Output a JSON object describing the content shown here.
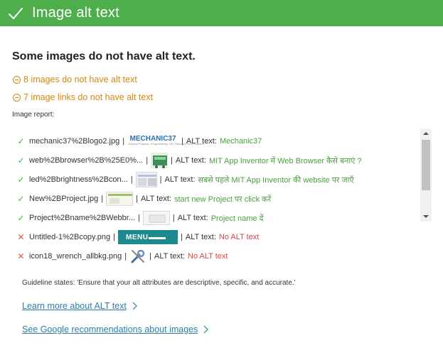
{
  "header": {
    "title": "Image alt text",
    "bg_color": "#4fae4c"
  },
  "summary": {
    "headline": "Some images do not have alt text.",
    "issues": [
      "8 images do not have alt text",
      "7 image links do not have alt text"
    ],
    "issue_color": "#d4880f"
  },
  "report": {
    "label": "Image report:",
    "alt_label": "ALT text:",
    "rows": [
      {
        "status": "ok",
        "file": "mechanic37%2Blogo2.jpg",
        "thumb": "mechanic37-logo",
        "thumb_text": "MECHANIC37",
        "thumb_subtext": "Arduino Projects, Programming, DIY, Robotics\nDo It Yourself",
        "alt": "Mechanic37"
      },
      {
        "status": "ok",
        "file": "web%2Bbrowser%2B%25E0%...",
        "thumb": "browser-thumbnail",
        "alt": "MIT App Inventor में Web Browser कैसे बनाएं ?"
      },
      {
        "status": "ok",
        "file": "led%2Bbrightness%2Bcon...",
        "thumb": "led-thumbnail",
        "alt": "सबसे पहले MIT App Inventor की website पर जाएँ"
      },
      {
        "status": "ok",
        "file": "New%2BProject.jpg",
        "thumb": "project-thumbnail",
        "alt": "start new Project पर click करें"
      },
      {
        "status": "ok",
        "file": "Project%2Bname%2BWebbr...",
        "thumb": "project-name-thumbnail",
        "alt": "Project name दें"
      },
      {
        "status": "bad",
        "file": "Untitled-1%2Bcopy.png",
        "thumb": "menu-thumbnail",
        "thumb_text": "MENU",
        "alt": "No ALT text"
      },
      {
        "status": "bad",
        "file": "icon18_wrench_allbkg.png",
        "thumb": "wrench-icon",
        "alt": "No ALT text"
      }
    ]
  },
  "guideline": "Guideline states: 'Ensure that your alt attributes are descriptive, specific, and accurate.'",
  "links": {
    "learn_more": "Learn more about ALT text",
    "google": "See Google recommendations about images"
  },
  "icons": {
    "header": "check-icon",
    "issue": "minus-circle-icon",
    "row_ok": "check-icon",
    "row_bad": "cross-icon",
    "link": "chevron-right-icon"
  }
}
